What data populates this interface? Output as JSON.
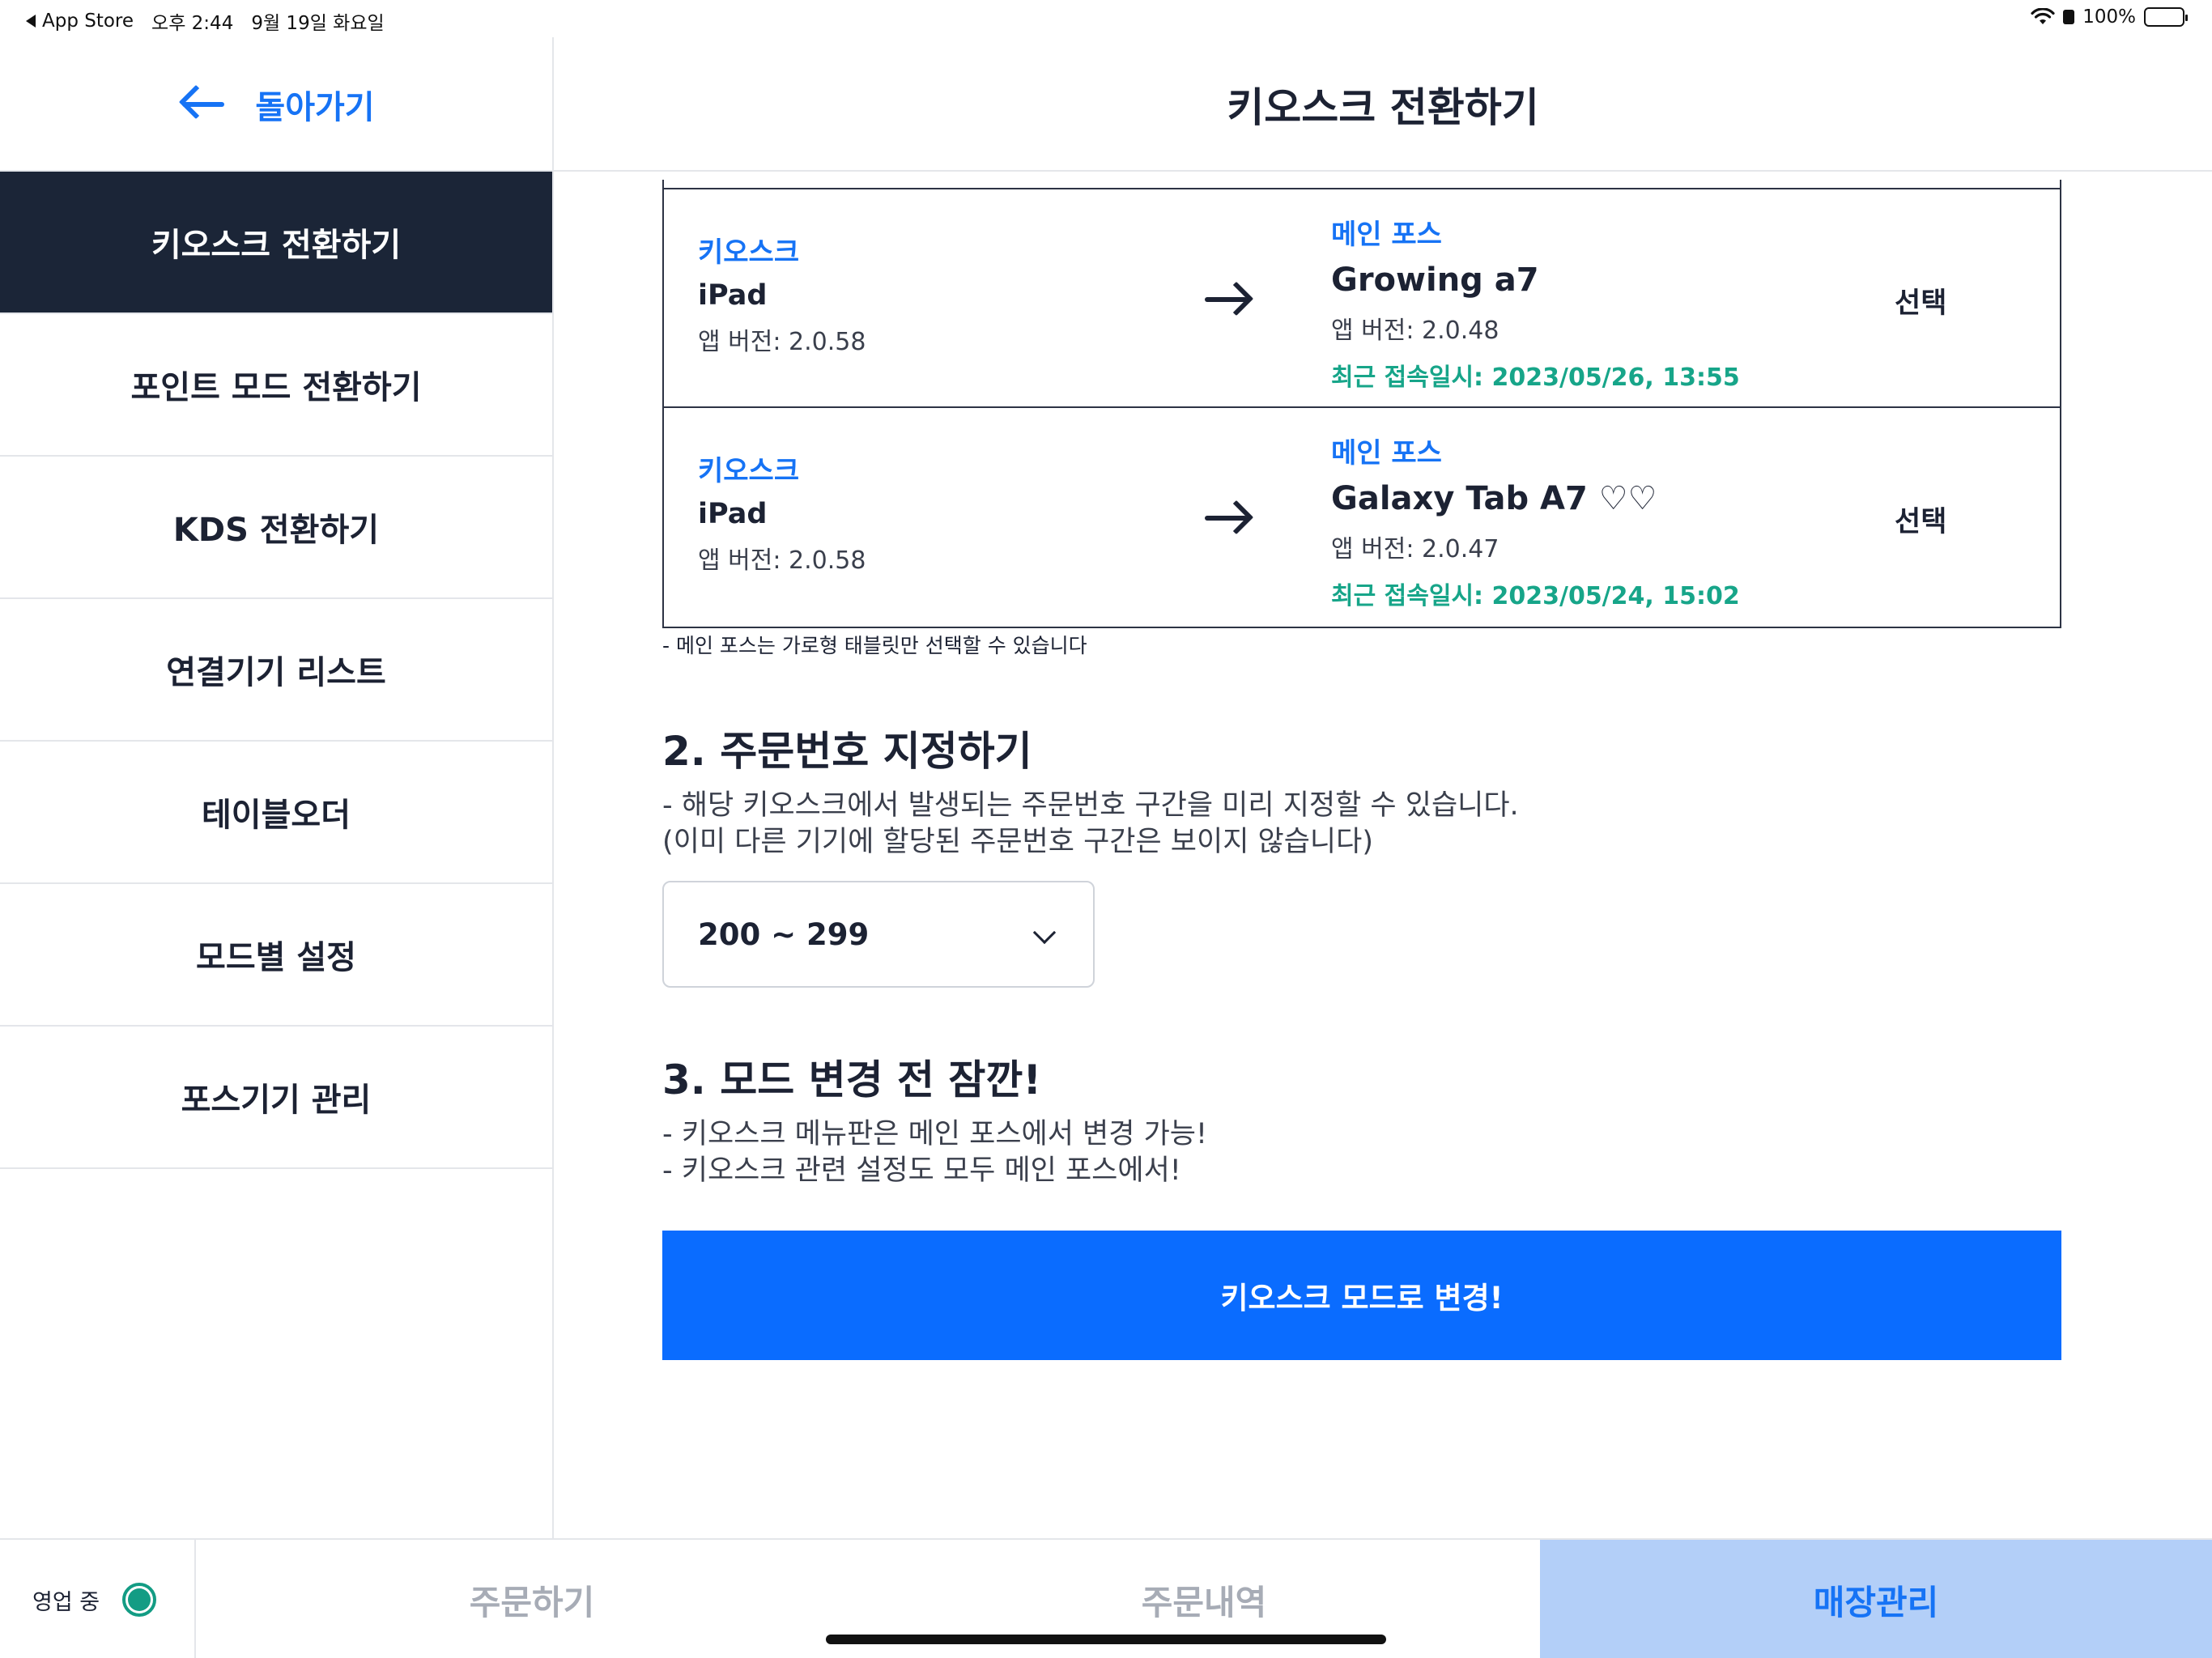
{
  "status_bar": {
    "back_app": "App Store",
    "time": "오후 2:44",
    "date": "9월 19일 화요일",
    "battery": "100%"
  },
  "header": {
    "back_label": "돌아가기",
    "title": "키오스크 전환하기"
  },
  "sidebar": {
    "items": [
      {
        "label": "키오스크 전환하기",
        "active": true
      },
      {
        "label": "포인트 모드 전환하기",
        "active": false
      },
      {
        "label": "KDS 전환하기",
        "active": false
      },
      {
        "label": "연결기기 리스트",
        "active": false
      },
      {
        "label": "테이블오더",
        "active": false
      },
      {
        "label": "모드별 설정",
        "active": false
      },
      {
        "label": "포스기기 관리",
        "active": false
      }
    ]
  },
  "devices": [
    {
      "src_label": "키오스크",
      "src_name": "iPad",
      "src_version": "앱 버전: 2.0.58",
      "dst_label": "메인 포스",
      "dst_name": "Growing a7",
      "dst_version": "앱 버전: 2.0.48",
      "dst_last": "최근 접속일시: 2023/05/26, 13:55",
      "select": "선택"
    },
    {
      "src_label": "키오스크",
      "src_name": "iPad",
      "src_version": "앱 버전: 2.0.58",
      "dst_label": "메인 포스",
      "dst_name": "Galaxy Tab A7 ♡♡",
      "dst_version": "앱 버전: 2.0.47",
      "dst_last": "최근 접속일시: 2023/05/24, 15:02",
      "select": "선택"
    }
  ],
  "table_note": "- 메인 포스는 가로형 태블릿만 선택할 수 있습니다",
  "section2": {
    "title": "2. 주문번호 지정하기",
    "desc1": "- 해당 키오스크에서 발생되는 주문번호 구간을 미리 지정할 수 있습니다.",
    "desc2": "(이미 다른 기기에 할당된 주문번호 구간은 보이지 않습니다)",
    "select_value": "200 ~ 299"
  },
  "section3": {
    "title": "3. 모드 변경 전 잠깐!",
    "desc1": "- 키오스크 메뉴판은 메인 포스에서 변경 가능!",
    "desc2": "- 키오스크 관련 설정도 모두 메인 포스에서!"
  },
  "cta_label": "키오스크 모드로 변경!",
  "tabbar": {
    "open_status": "영업 중",
    "tabs": [
      "주문하기",
      "주문내역",
      "매장관리"
    ],
    "active_tab": "매장관리"
  },
  "colors": {
    "accent": "#1673f5",
    "cta": "#0a6cff",
    "sidebar_active": "#1b2537",
    "last_access": "#17a589",
    "active_tab_bg": "#b3cff8"
  },
  "icons": [
    "back-arrow-icon",
    "right-arrow-icon",
    "chevron-down-icon",
    "wifi-icon",
    "battery-icon"
  ]
}
